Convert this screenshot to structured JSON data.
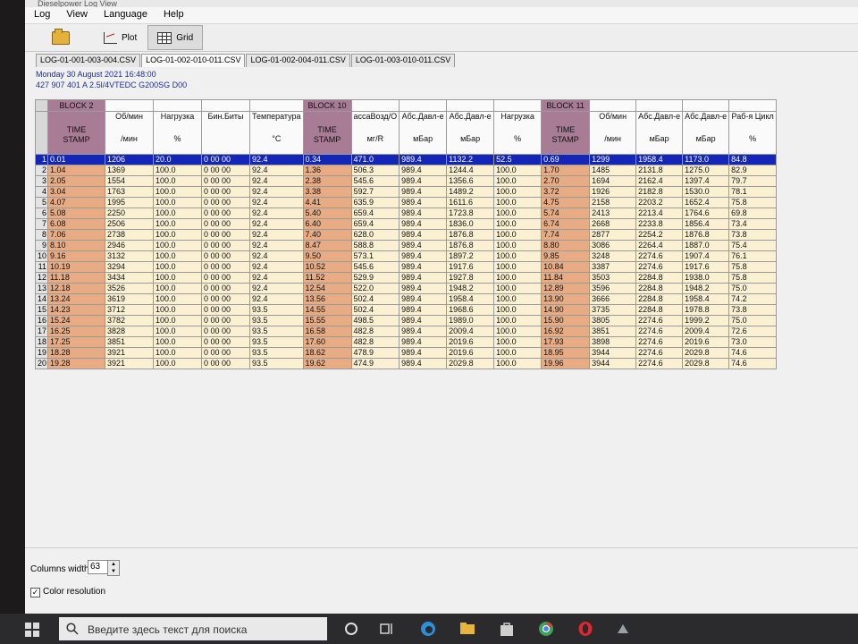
{
  "window": {
    "title": "Dieselpower Log View"
  },
  "menu": [
    "Log",
    "View",
    "Language",
    "Help"
  ],
  "toolbar": {
    "plot_label": "Plot",
    "grid_label": "Grid"
  },
  "tabs": [
    {
      "label": "LOG-01-001-003-004.CSV",
      "active": false
    },
    {
      "label": "LOG-01-002-010-011.CSV",
      "active": true
    },
    {
      "label": "LOG-01-002-004-011.CSV",
      "active": false
    },
    {
      "label": "LOG-01-003-010-011.CSV",
      "active": false
    }
  ],
  "info": {
    "date": "Monday 30 August 2021 16:48:00",
    "engine": "427 907 401 A  2.5l/4VTEDC G200SG D00"
  },
  "grid": {
    "block_headers": [
      "BLOCK 2",
      "BLOCK 10",
      "BLOCK 11"
    ],
    "column_headers": [
      {
        "line1": "TIME",
        "line2": "STAMP"
      },
      {
        "line1": "Об/мин",
        "line2": "/мин"
      },
      {
        "line1": "Нагрузка",
        "line2": "%"
      },
      {
        "line1": "Бин.Биты",
        "line2": ""
      },
      {
        "line1": "Температура",
        "line2": "°C"
      },
      {
        "line1": "TIME",
        "line2": "STAMP"
      },
      {
        "line1": "ассаВозд/О",
        "line2": "мг/R"
      },
      {
        "line1": "Абс.Давл-е",
        "line2": "мБар"
      },
      {
        "line1": "Абс.Давл-е",
        "line2": "мБар"
      },
      {
        "line1": "Нагрузка",
        "line2": "%"
      },
      {
        "line1": "TIME",
        "line2": "STAMP"
      },
      {
        "line1": "Об/мин",
        "line2": "/мин"
      },
      {
        "line1": "Абс.Давл-е",
        "line2": "мБар"
      },
      {
        "line1": "Абс.Давл-е",
        "line2": "мБар"
      },
      {
        "line1": "Раб-я Цикл",
        "line2": "%"
      }
    ],
    "rows": [
      [
        "0.01",
        "1206",
        "20.0",
        "0 00 00",
        "92.4",
        "0.34",
        "471.0",
        "989.4",
        "1132.2",
        "52.5",
        "0.69",
        "1299",
        "1958.4",
        "1173.0",
        "84.8"
      ],
      [
        "1.04",
        "1369",
        "100.0",
        "0 00 00",
        "92.4",
        "1.36",
        "506.3",
        "989.4",
        "1244.4",
        "100.0",
        "1.70",
        "1485",
        "2131.8",
        "1275.0",
        "82.9"
      ],
      [
        "2.05",
        "1554",
        "100.0",
        "0 00 00",
        "92.4",
        "2.38",
        "545.6",
        "989.4",
        "1356.6",
        "100.0",
        "2.70",
        "1694",
        "2162.4",
        "1397.4",
        "79.7"
      ],
      [
        "3.04",
        "1763",
        "100.0",
        "0 00 00",
        "92.4",
        "3.38",
        "592.7",
        "989.4",
        "1489.2",
        "100.0",
        "3.72",
        "1926",
        "2182.8",
        "1530.0",
        "78.1"
      ],
      [
        "4.07",
        "1995",
        "100.0",
        "0 00 00",
        "92.4",
        "4.41",
        "635.9",
        "989.4",
        "1611.6",
        "100.0",
        "4.75",
        "2158",
        "2203.2",
        "1652.4",
        "75.8"
      ],
      [
        "5.08",
        "2250",
        "100.0",
        "0 00 00",
        "92.4",
        "5.40",
        "659.4",
        "989.4",
        "1723.8",
        "100.0",
        "5.74",
        "2413",
        "2213.4",
        "1764.6",
        "69.8"
      ],
      [
        "6.08",
        "2506",
        "100.0",
        "0 00 00",
        "92.4",
        "6.40",
        "659.4",
        "989.4",
        "1836.0",
        "100.0",
        "6.74",
        "2668",
        "2233.8",
        "1856.4",
        "73.4"
      ],
      [
        "7.06",
        "2738",
        "100.0",
        "0 00 00",
        "92.4",
        "7.40",
        "628.0",
        "989.4",
        "1876.8",
        "100.0",
        "7.74",
        "2877",
        "2254.2",
        "1876.8",
        "73.8"
      ],
      [
        "8.10",
        "2946",
        "100.0",
        "0 00 00",
        "92.4",
        "8.47",
        "588.8",
        "989.4",
        "1876.8",
        "100.0",
        "8.80",
        "3086",
        "2264.4",
        "1887.0",
        "75.4"
      ],
      [
        "9.16",
        "3132",
        "100.0",
        "0 00 00",
        "92.4",
        "9.50",
        "573.1",
        "989.4",
        "1897.2",
        "100.0",
        "9.85",
        "3248",
        "2274.6",
        "1907.4",
        "76.1"
      ],
      [
        "10.19",
        "3294",
        "100.0",
        "0 00 00",
        "92.4",
        "10.52",
        "545.6",
        "989.4",
        "1917.6",
        "100.0",
        "10.84",
        "3387",
        "2274.6",
        "1917.6",
        "75.8"
      ],
      [
        "11.18",
        "3434",
        "100.0",
        "0 00 00",
        "92.4",
        "11.52",
        "529.9",
        "989.4",
        "1927.8",
        "100.0",
        "11.84",
        "3503",
        "2284.8",
        "1938.0",
        "75.8"
      ],
      [
        "12.18",
        "3526",
        "100.0",
        "0 00 00",
        "92.4",
        "12.54",
        "522.0",
        "989.4",
        "1948.2",
        "100.0",
        "12.89",
        "3596",
        "2284.8",
        "1948.2",
        "75.0"
      ],
      [
        "13.24",
        "3619",
        "100.0",
        "0 00 00",
        "92.4",
        "13.56",
        "502.4",
        "989.4",
        "1958.4",
        "100.0",
        "13.90",
        "3666",
        "2284.8",
        "1958.4",
        "74.2"
      ],
      [
        "14.23",
        "3712",
        "100.0",
        "0 00 00",
        "93.5",
        "14.55",
        "502.4",
        "989.4",
        "1968.6",
        "100.0",
        "14.90",
        "3735",
        "2284.8",
        "1978.8",
        "73.8"
      ],
      [
        "15.24",
        "3782",
        "100.0",
        "0 00 00",
        "93.5",
        "15.55",
        "498.5",
        "989.4",
        "1989.0",
        "100.0",
        "15.90",
        "3805",
        "2274.6",
        "1999.2",
        "75.0"
      ],
      [
        "16.25",
        "3828",
        "100.0",
        "0 00 00",
        "93.5",
        "16.58",
        "482.8",
        "989.4",
        "2009.4",
        "100.0",
        "16.92",
        "3851",
        "2274.6",
        "2009.4",
        "72.6"
      ],
      [
        "17.25",
        "3851",
        "100.0",
        "0 00 00",
        "93.5",
        "17.60",
        "482.8",
        "989.4",
        "2019.6",
        "100.0",
        "17.93",
        "3898",
        "2274.6",
        "2019.6",
        "73.0"
      ],
      [
        "18.28",
        "3921",
        "100.0",
        "0 00 00",
        "93.5",
        "18.62",
        "478.9",
        "989.4",
        "2019.6",
        "100.0",
        "18.95",
        "3944",
        "2274.6",
        "2029.8",
        "74.6"
      ],
      [
        "19.28",
        "3921",
        "100.0",
        "0 00 00",
        "93.5",
        "19.62",
        "474.9",
        "989.4",
        "2029.8",
        "100.0",
        "19.96",
        "3944",
        "2274.6",
        "2029.8",
        "74.6"
      ]
    ]
  },
  "bottom": {
    "columns_width_label": "Columns width:",
    "columns_width_value": "63",
    "color_resolution_label": "Color resolution",
    "color_resolution_checked": true
  },
  "taskbar": {
    "search_placeholder": "Введите здесь текст для поиска"
  },
  "colors": {
    "block_header": "#a87c95",
    "timestamp_cell": "#e8ac84",
    "data_cell": "#fbf1d2",
    "selection": "#1426b8"
  }
}
